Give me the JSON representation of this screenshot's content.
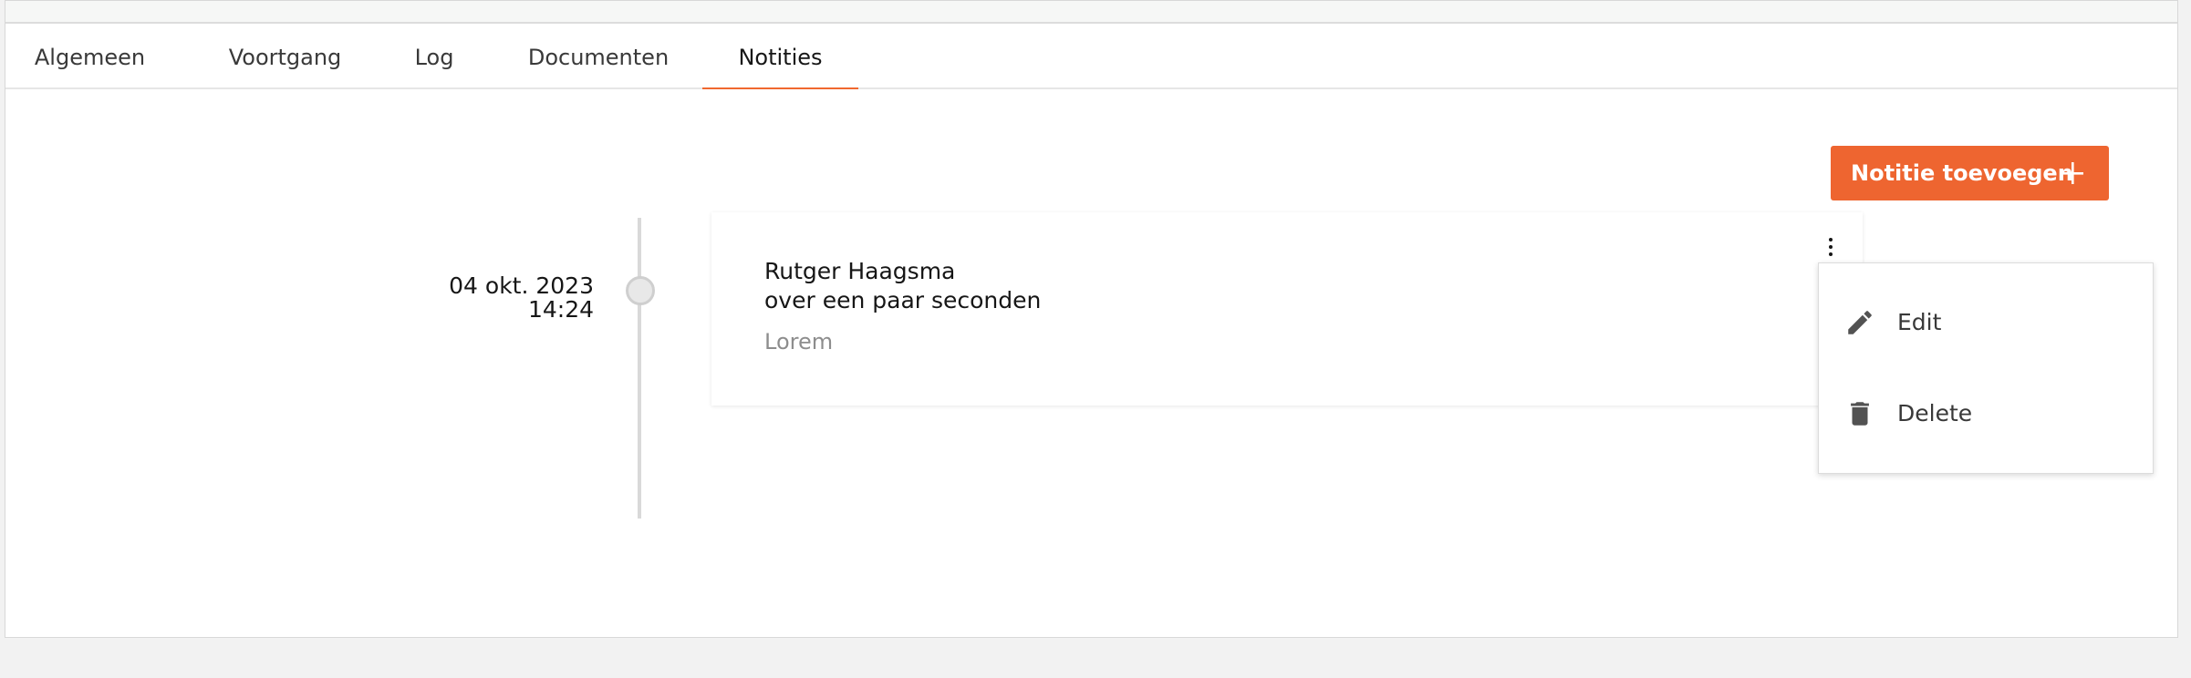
{
  "tabs": [
    {
      "label": "Algemeen"
    },
    {
      "label": "Voortgang"
    },
    {
      "label": "Log"
    },
    {
      "label": "Documenten"
    },
    {
      "label": "Notities"
    }
  ],
  "active_tab": "Notities",
  "actions": {
    "add_note_label": "Notitie toevoegen"
  },
  "timeline": {
    "entries": [
      {
        "date": "04 okt. 2023",
        "time": "14:24",
        "author": "Rutger Haagsma",
        "relative_time": "over een paar seconden",
        "text": "Lorem"
      }
    ]
  },
  "context_menu": {
    "items": [
      {
        "label": "Edit",
        "icon": "pencil-icon"
      },
      {
        "label": "Delete",
        "icon": "trash-icon"
      }
    ]
  },
  "colors": {
    "accent": "#ee6530"
  }
}
